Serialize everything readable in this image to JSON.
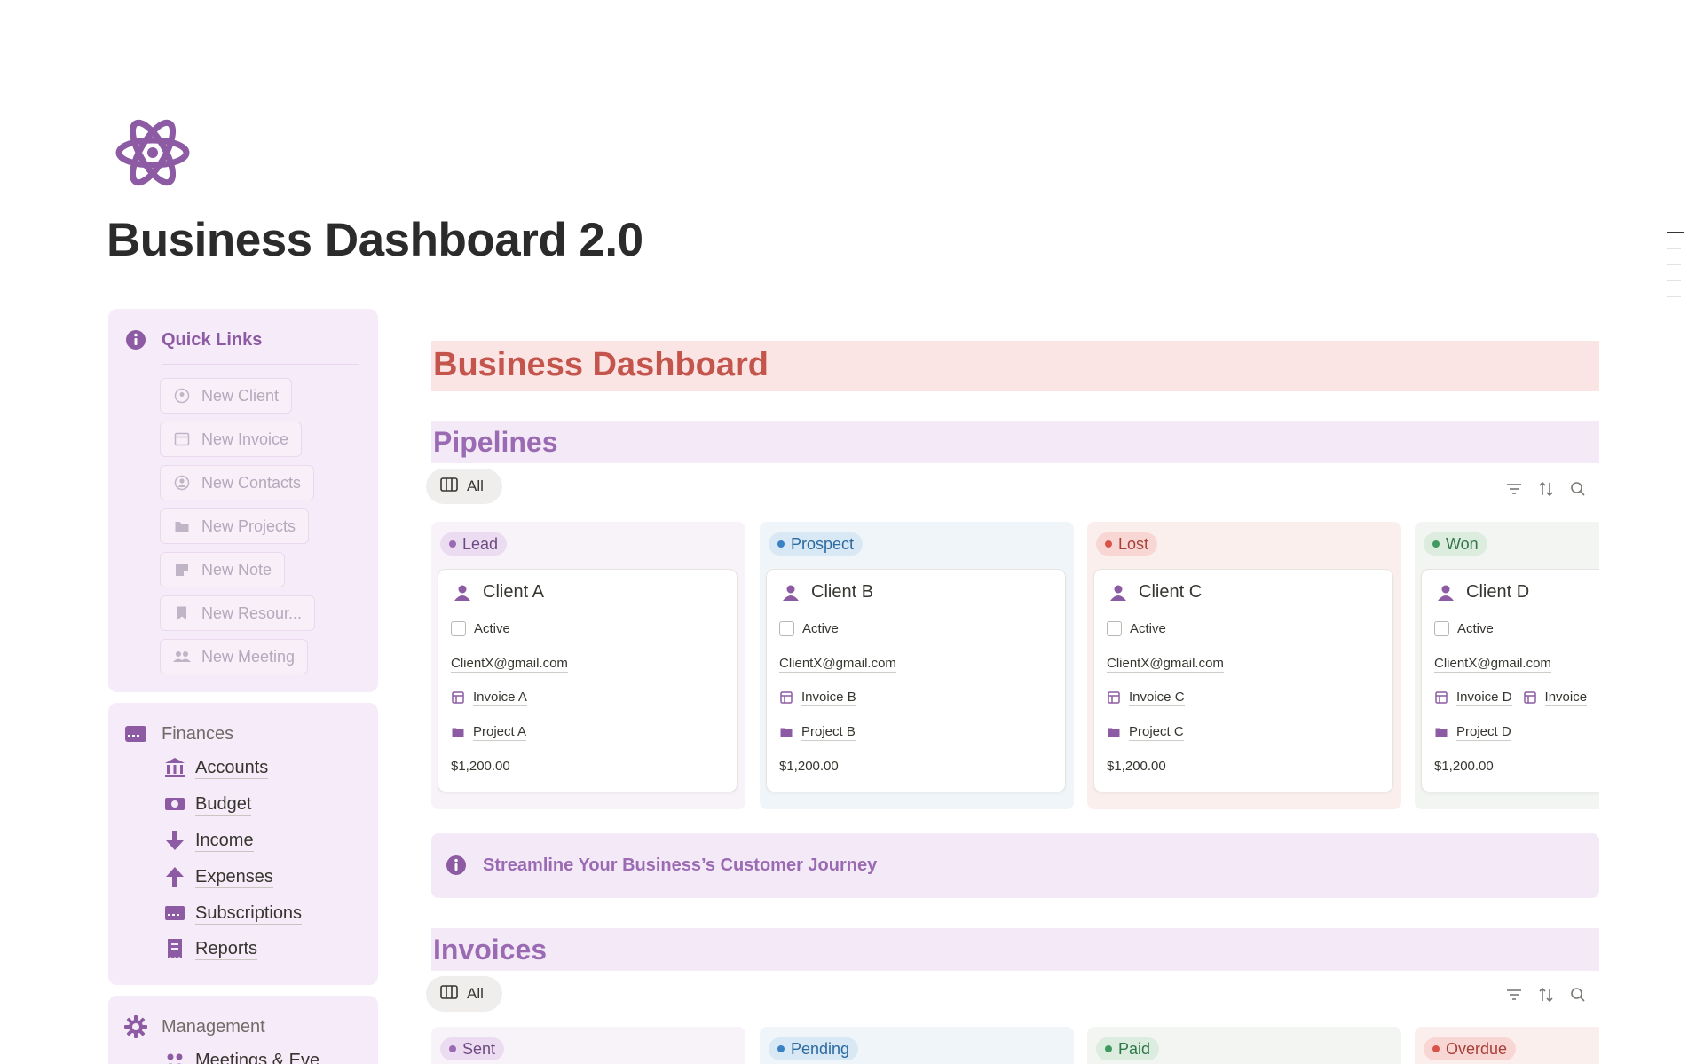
{
  "page": {
    "title": "Business Dashboard 2.0",
    "icon": "atom-icon",
    "accent": "#8c5ba3"
  },
  "sidebar": {
    "quick_links": {
      "title": "Quick Links",
      "icon": "info-icon",
      "items": [
        {
          "label": "New Client",
          "icon": "client-icon"
        },
        {
          "label": "New Invoice",
          "icon": "invoice-icon"
        },
        {
          "label": "New Contacts",
          "icon": "contact-icon"
        },
        {
          "label": "New Projects",
          "icon": "folder-icon"
        },
        {
          "label": "New Note",
          "icon": "note-icon"
        },
        {
          "label": "New Resour...",
          "icon": "bookmark-icon"
        },
        {
          "label": "New Meeting",
          "icon": "people-icon"
        }
      ]
    },
    "finances": {
      "title": "Finances",
      "icon": "card-icon",
      "items": [
        {
          "label": "Accounts",
          "icon": "bank-icon"
        },
        {
          "label": "Budget",
          "icon": "cash-icon"
        },
        {
          "label": "Income",
          "icon": "arrow-down-icon"
        },
        {
          "label": "Expenses",
          "icon": "arrow-up-icon"
        },
        {
          "label": "Subscriptions",
          "icon": "card-icon"
        },
        {
          "label": "Reports",
          "icon": "receipt-icon"
        }
      ]
    },
    "management": {
      "title": "Management",
      "icon": "gear-icon",
      "items": [
        {
          "label": "Meetings & Eve",
          "icon": "people-icon"
        }
      ]
    }
  },
  "main": {
    "banner": "Business Dashboard",
    "pipelines": {
      "title": "Pipelines",
      "view_label": "All",
      "columns": [
        {
          "status": "Lead",
          "color": "#9a6bb3",
          "bg": "#ecdcf2",
          "card": {
            "name": "Client A",
            "status_label": "Active",
            "email": "ClientX@gmail.com",
            "invoice": "Invoice A",
            "project": "Project A",
            "amount": "$1,200.00"
          }
        },
        {
          "status": "Prospect",
          "color": "#3b82c4",
          "bg": "#d8e8f5",
          "card": {
            "name": "Client B",
            "status_label": "Active",
            "email": "ClientX@gmail.com",
            "invoice": "Invoice B",
            "project": "Project B",
            "amount": "$1,200.00"
          }
        },
        {
          "status": "Lost",
          "color": "#d9534a",
          "bg": "#f8d6d3",
          "card": {
            "name": "Client C",
            "status_label": "Active",
            "email": "ClientX@gmail.com",
            "invoice": "Invoice C",
            "project": "Project C",
            "amount": "$1,200.00"
          }
        },
        {
          "status": "Won",
          "color": "#3f9a5f",
          "bg": "#dcecdf",
          "card": {
            "name": "Client D",
            "status_label": "Active",
            "email": "ClientX@gmail.com",
            "invoice": "Invoice D",
            "invoice2": "Invoice",
            "project": "Project D",
            "amount": "$1,200.00"
          }
        }
      ]
    },
    "callout": "Streamline Your Business’s Customer Journey",
    "invoices": {
      "title": "Invoices",
      "view_label": "All",
      "columns": [
        {
          "status": "Sent",
          "color": "#9a6bb3",
          "bg": "#ecdcf2"
        },
        {
          "status": "Pending",
          "color": "#3b82c4",
          "bg": "#d8e8f5"
        },
        {
          "status": "Paid",
          "color": "#3f9a5f",
          "bg": "#dcecdf"
        },
        {
          "status": "Overdue",
          "color": "#d9534a",
          "bg": "#f8d6d3"
        }
      ]
    }
  }
}
